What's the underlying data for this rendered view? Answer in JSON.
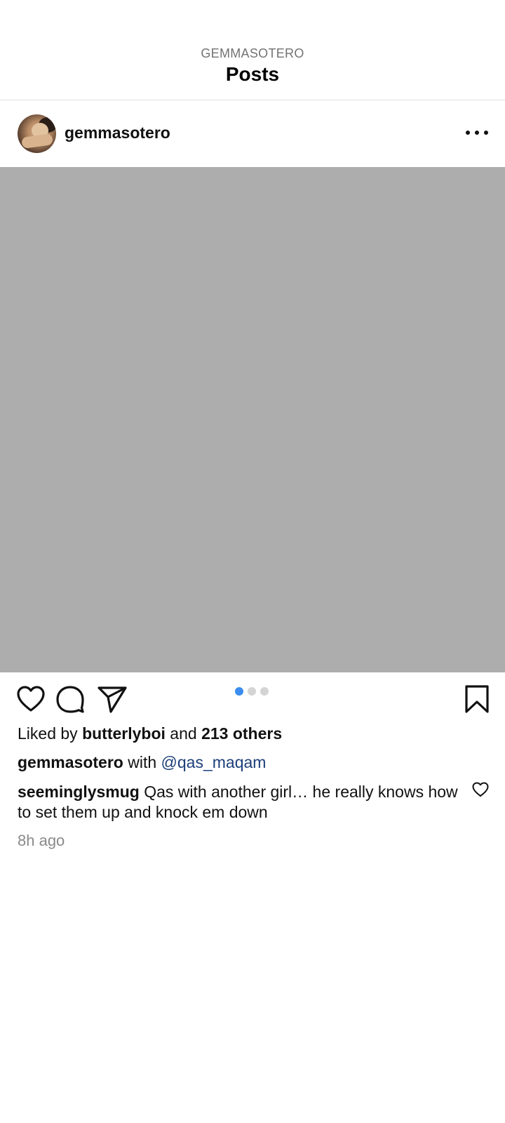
{
  "header": {
    "subtitle": "GEMMASOTERO",
    "title": "Posts"
  },
  "post": {
    "username": "gemmasotero",
    "more_icon": "more-horizontal-icon",
    "carousel": {
      "count": 3,
      "active_index": 0,
      "active_color": "#3b8df0"
    },
    "actions": {
      "like_icon": "heart-icon",
      "comment_icon": "comment-bubble-icon",
      "share_icon": "send-paper-plane-icon",
      "save_icon": "bookmark-icon"
    },
    "likes": {
      "prefix": "Liked by",
      "user": "butterlyboi",
      "joiner": "and",
      "others": "213 others"
    },
    "caption": {
      "user": "gemmasotero",
      "with_text": "with",
      "mention": "@qas_maqam"
    },
    "comment": {
      "user": "seeminglysmug",
      "text": "Qas with another girl… he really knows how to set them up and knock em down",
      "like_icon": "heart-small-icon"
    },
    "timestamp": "8h ago"
  },
  "colors": {
    "mention": "#1d3f7a",
    "image_placeholder": "#adadad",
    "muted_text": "#737373"
  }
}
